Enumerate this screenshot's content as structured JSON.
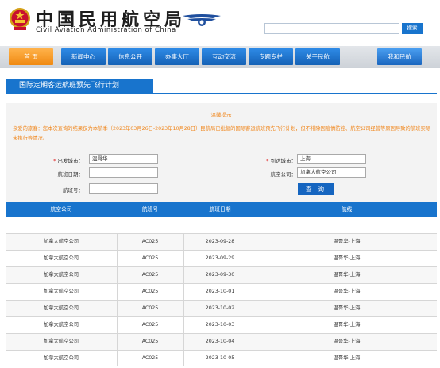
{
  "header": {
    "brand_cn": "中国民用航空局",
    "brand_en": "Civil Aviation Administration of China",
    "search_button": "搜索"
  },
  "nav": {
    "items": [
      {
        "label": "首 页",
        "active": true
      },
      {
        "label": "新闻中心"
      },
      {
        "label": "信息公开"
      },
      {
        "label": "办事大厅"
      },
      {
        "label": "互动交流"
      },
      {
        "label": "专题专栏"
      },
      {
        "label": "关于民航"
      },
      {
        "label": "我和民航"
      }
    ]
  },
  "page_title": "国际定期客运航班预先飞行计划",
  "notice": {
    "title": "温馨提示",
    "text": "亲爱的旅客：您本次查询的结果仅为本航季（2023年03月26日-2023年10月28日）民航局已批复的国际客运航班预先飞行计划，但不排除因疫情防控、航空公司经营等原因导致的航班实际未执行等情况。"
  },
  "form": {
    "departure_label": "出发城市：",
    "departure_value": "温哥华",
    "arrival_label": "到达城市：",
    "arrival_value": "上海",
    "date_label": "航班日期：",
    "date_value": "",
    "airline_label": "航空公司：",
    "airline_value": "加拿大航空公司",
    "flight_label": "航班号：",
    "flight_value": "",
    "query_button": "查 询"
  },
  "table": {
    "columns": [
      "航空公司",
      "航班号",
      "航班日期",
      "航线"
    ],
    "rows": [
      [
        "加拿大航空公司",
        "AC025",
        "2023-09-28",
        "温哥华-上海"
      ],
      [
        "加拿大航空公司",
        "AC025",
        "2023-09-29",
        "温哥华-上海"
      ],
      [
        "加拿大航空公司",
        "AC025",
        "2023-09-30",
        "温哥华-上海"
      ],
      [
        "加拿大航空公司",
        "AC025",
        "2023-10-01",
        "温哥华-上海"
      ],
      [
        "加拿大航空公司",
        "AC025",
        "2023-10-02",
        "温哥华-上海"
      ],
      [
        "加拿大航空公司",
        "AC025",
        "2023-10-03",
        "温哥华-上海"
      ],
      [
        "加拿大航空公司",
        "AC025",
        "2023-10-04",
        "温哥华-上海"
      ],
      [
        "加拿大航空公司",
        "AC025",
        "2023-10-05",
        "温哥华-上海"
      ]
    ]
  },
  "colors": {
    "primary_blue": "#1874cd",
    "active_orange": "#f08a12",
    "notice_orange": "#f08519"
  }
}
